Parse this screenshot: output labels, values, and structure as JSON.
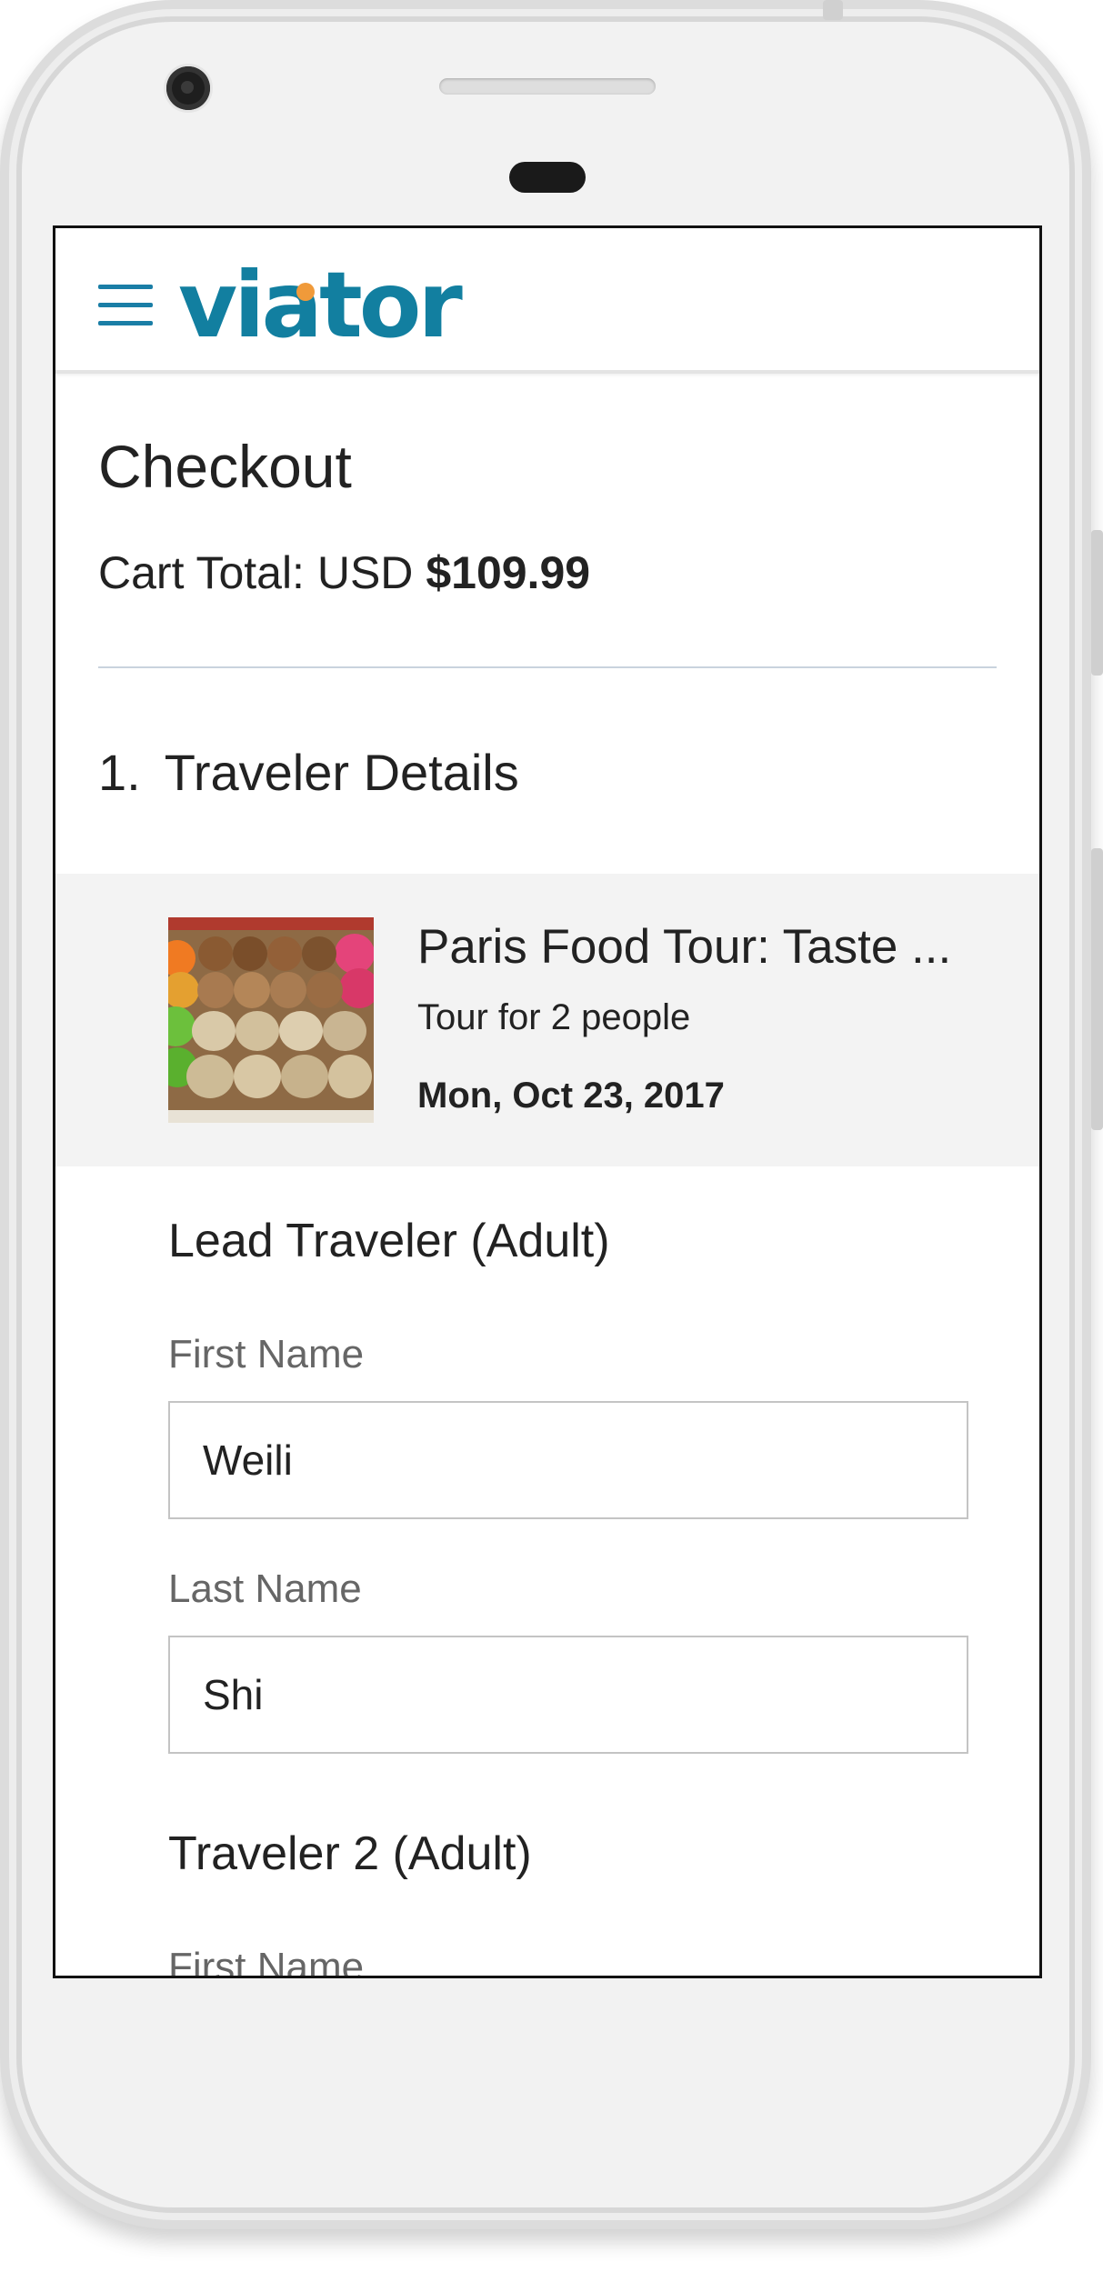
{
  "header": {
    "logo_text": "viator",
    "brand_color": "#127fa0",
    "logo_dot_color": "#f09a3a"
  },
  "checkout": {
    "title": "Checkout",
    "cart_total_prefix": "Cart Total: USD",
    "cart_total_amount": "$109.99"
  },
  "section": {
    "number": "1.",
    "title": "Traveler Details"
  },
  "tour": {
    "name": "Paris Food Tour: Taste ...",
    "subtitle": "Tour for 2 people",
    "date": "Mon, Oct 23, 2017"
  },
  "travelers": [
    {
      "heading": "Lead Traveler (Adult)",
      "first_name_label": "First Name",
      "first_name_value": "Weili",
      "last_name_label": "Last Name",
      "last_name_value": "Shi"
    },
    {
      "heading": "Traveler 2 (Adult)",
      "first_name_label": "First Name"
    }
  ]
}
